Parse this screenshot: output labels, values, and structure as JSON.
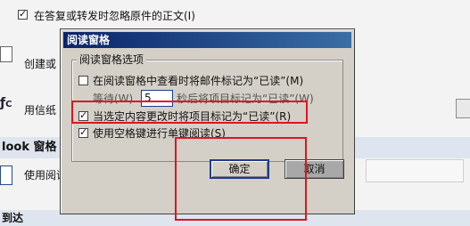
{
  "background": {
    "ignore_original_label": "在答复或转发时忽略原件的正文(I)",
    "create_label": "创建或",
    "stationery_label": "用信纸",
    "section_title": "look 窗格",
    "use_reading_label": "使用阅读",
    "bottom_label": "到达"
  },
  "dialog": {
    "title": "阅读窗格",
    "group_label": "阅读窗格选项",
    "option1_label": "在阅读窗格中查看时将邮件标记为“已读”(M)",
    "wait_prefix": "等待(W)",
    "wait_value": "5",
    "wait_suffix": "秒后将项目标记为“已读”(W)",
    "option2_label": "当选定内容更改时将项目标记为“已读”(R)",
    "option3_label": "使用空格键进行单键阅读(S)",
    "ok_label": "确定",
    "cancel_label": "取消"
  },
  "colors": {
    "highlight": "#e0141e",
    "titlebar": "#0a246a"
  }
}
